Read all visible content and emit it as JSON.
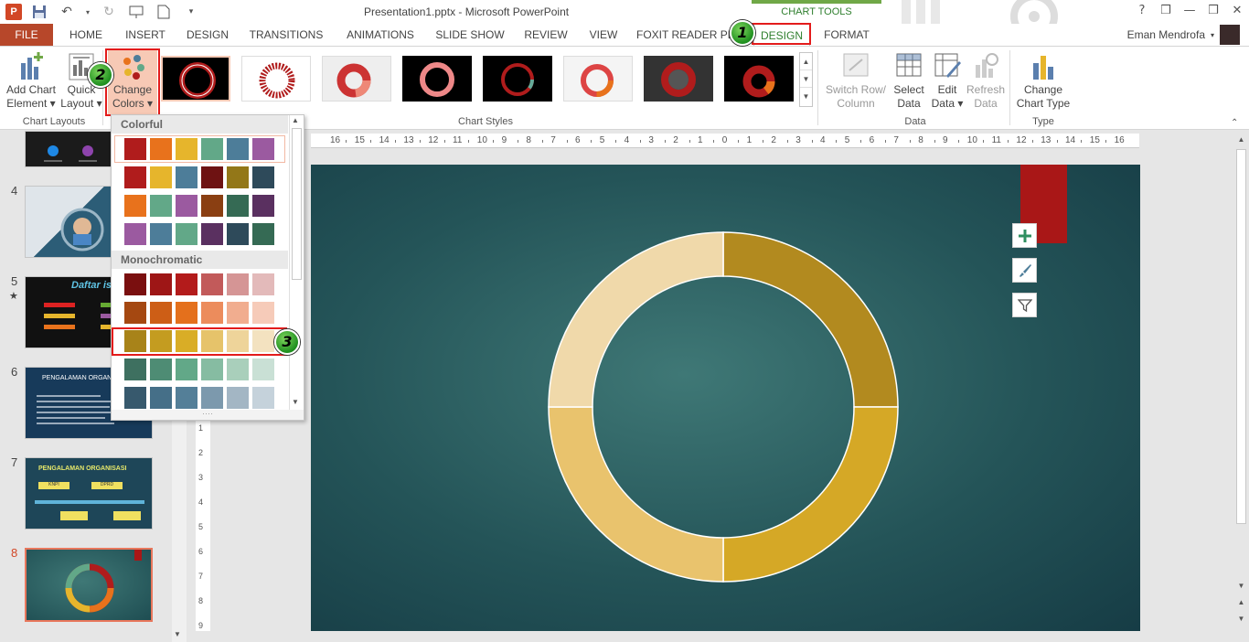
{
  "window": {
    "title": "Presentation1.pptx - Microsoft PowerPoint",
    "chart_tools_label": "CHART TOOLS",
    "user_name": "Eman Mendrofa",
    "controls": [
      "?",
      "❒",
      "—",
      "❒",
      "✕"
    ]
  },
  "tabs": {
    "file": "FILE",
    "home": "HOME",
    "insert": "INSERT",
    "design": "DESIGN",
    "transitions": "TRANSITIONS",
    "animations": "ANIMATIONS",
    "slide_show": "SLIDE SHOW",
    "review": "REVIEW",
    "view": "VIEW",
    "foxit": "FOXIT READER PDF",
    "chart_design": "DESIGN",
    "format": "FORMAT"
  },
  "ribbon": {
    "add_chart_element": [
      "Add Chart",
      "Element ▾"
    ],
    "quick_layout": [
      "Quick",
      "Layout ▾"
    ],
    "change_colors": [
      "Change",
      "Colors ▾"
    ],
    "switch_row_col": [
      "Switch Row/",
      "Column"
    ],
    "select_data": [
      "Select",
      "Data"
    ],
    "edit_data": [
      "Edit",
      "Data ▾"
    ],
    "refresh_data": [
      "Refresh",
      "Data"
    ],
    "change_chart_type": [
      "Change",
      "Chart Type"
    ],
    "groups": {
      "chart_layouts": "Chart Layouts",
      "chart_styles": "Chart Styles",
      "data": "Data",
      "type": "Type"
    }
  },
  "callouts": [
    "1",
    "2",
    "3"
  ],
  "colors_dropdown": {
    "colorful_header": "Colorful",
    "mono_header": "Monochromatic",
    "colorful_rows": [
      [
        "#b01c1c",
        "#e8721c",
        "#e6b52c",
        "#62a888",
        "#4d7d99",
        "#9b5aa0"
      ],
      [
        "#b01c1c",
        "#e6b52c",
        "#4d7d99",
        "#6e1212",
        "#937718",
        "#2e4a5a"
      ],
      [
        "#e8721c",
        "#62a888",
        "#9b5aa0",
        "#8a3f12",
        "#356a54",
        "#5a3060"
      ],
      [
        "#9b5aa0",
        "#4d7d99",
        "#62a888",
        "#5a3060",
        "#2e4a5a",
        "#356a54"
      ]
    ],
    "mono_rows": [
      [
        "#7a0f0f",
        "#9e1616",
        "#b31b1b",
        "#c25a5a",
        "#d59595",
        "#e3baba"
      ],
      [
        "#a54811",
        "#cd5e16",
        "#e4701c",
        "#ec8c5c",
        "#f1ad8f",
        "#f6cbb9"
      ],
      [
        "#a88319",
        "#c49c20",
        "#d9ad26",
        "#e6c36a",
        "#eed49a",
        "#f3e2c0"
      ],
      [
        "#3e7060",
        "#4e8c74",
        "#62a888",
        "#86bca2",
        "#a9cfbb",
        "#c9e0d5"
      ],
      [
        "#37596d",
        "#456f88",
        "#547f98",
        "#7c99ad",
        "#a3b6c4",
        "#c5d2db"
      ]
    ]
  },
  "slides": {
    "numbers": [
      "4",
      "5",
      "★",
      "6",
      "7",
      "8"
    ],
    "slide5_title": "Daftar isi",
    "slide6_title": "PENGALAMAN ORGAN",
    "slide7_title": "PENGALAMAN ORGANISASI",
    "slide7_boxes": [
      "KNPI",
      "DPRD"
    ]
  },
  "ruler": {
    "h_labels": [
      "16",
      "15",
      "14",
      "13",
      "12",
      "11",
      "10",
      "9",
      "8",
      "7",
      "6",
      "5",
      "4",
      "3",
      "2",
      "1",
      "0",
      "1",
      "2",
      "3",
      "4",
      "5",
      "6",
      "7",
      "8",
      "9",
      "10",
      "11",
      "12",
      "13",
      "14",
      "15",
      "16"
    ],
    "v_labels": [
      "1",
      "2",
      "3",
      "4",
      "5",
      "6",
      "7",
      "8",
      "9"
    ]
  },
  "chart_data": {
    "type": "pie",
    "variant": "donut",
    "categories": [
      "",
      "",
      "",
      ""
    ],
    "values": [
      25,
      25,
      25,
      25
    ],
    "colors": [
      "#b28a1f",
      "#d5a826",
      "#e9c36d",
      "#f0d9aa"
    ]
  }
}
